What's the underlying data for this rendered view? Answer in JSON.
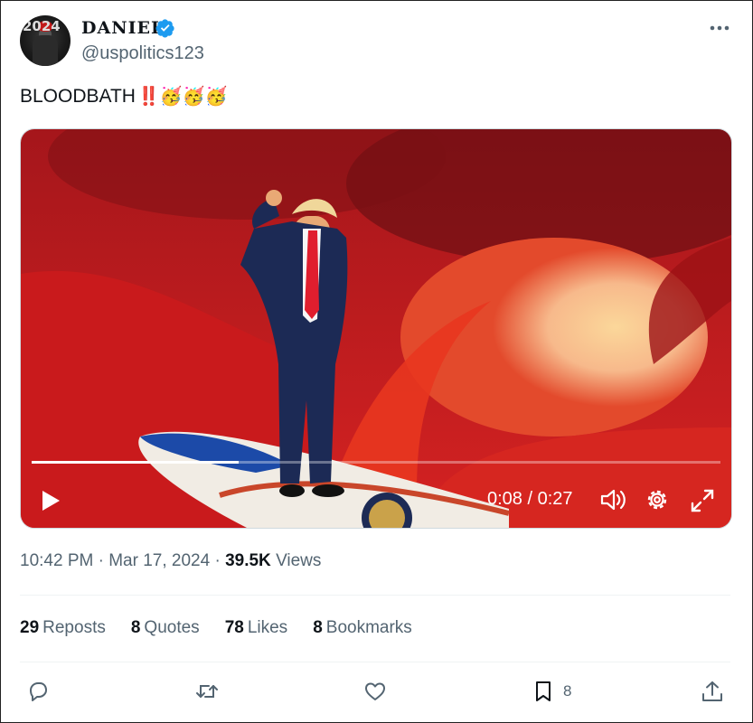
{
  "author": {
    "name": "DANIEL",
    "handle": "@uspolitics123",
    "avatar_year": "2024"
  },
  "post": {
    "text": "BLOODBATH",
    "emoji": "‼️🥳🥳🥳"
  },
  "video": {
    "progress": 0.3,
    "time_display": "0:08 / 0:27",
    "icons": [
      "play-icon",
      "volume-icon",
      "settings-gear-icon",
      "fullscreen-icon"
    ]
  },
  "meta": {
    "time": "10:42 PM",
    "separator": "·",
    "date": "Mar 17, 2024",
    "views_count": "39.5K",
    "views_label": "Views"
  },
  "stats": [
    {
      "count": "29",
      "label": "Reposts"
    },
    {
      "count": "8",
      "label": "Quotes"
    },
    {
      "count": "78",
      "label": "Likes"
    },
    {
      "count": "8",
      "label": "Bookmarks"
    }
  ],
  "actions": {
    "bookmark_count": "8"
  },
  "colors": {
    "accent": "#1d9bf0",
    "text_secondary": "#536471",
    "wave_red": "#d81c1c"
  }
}
